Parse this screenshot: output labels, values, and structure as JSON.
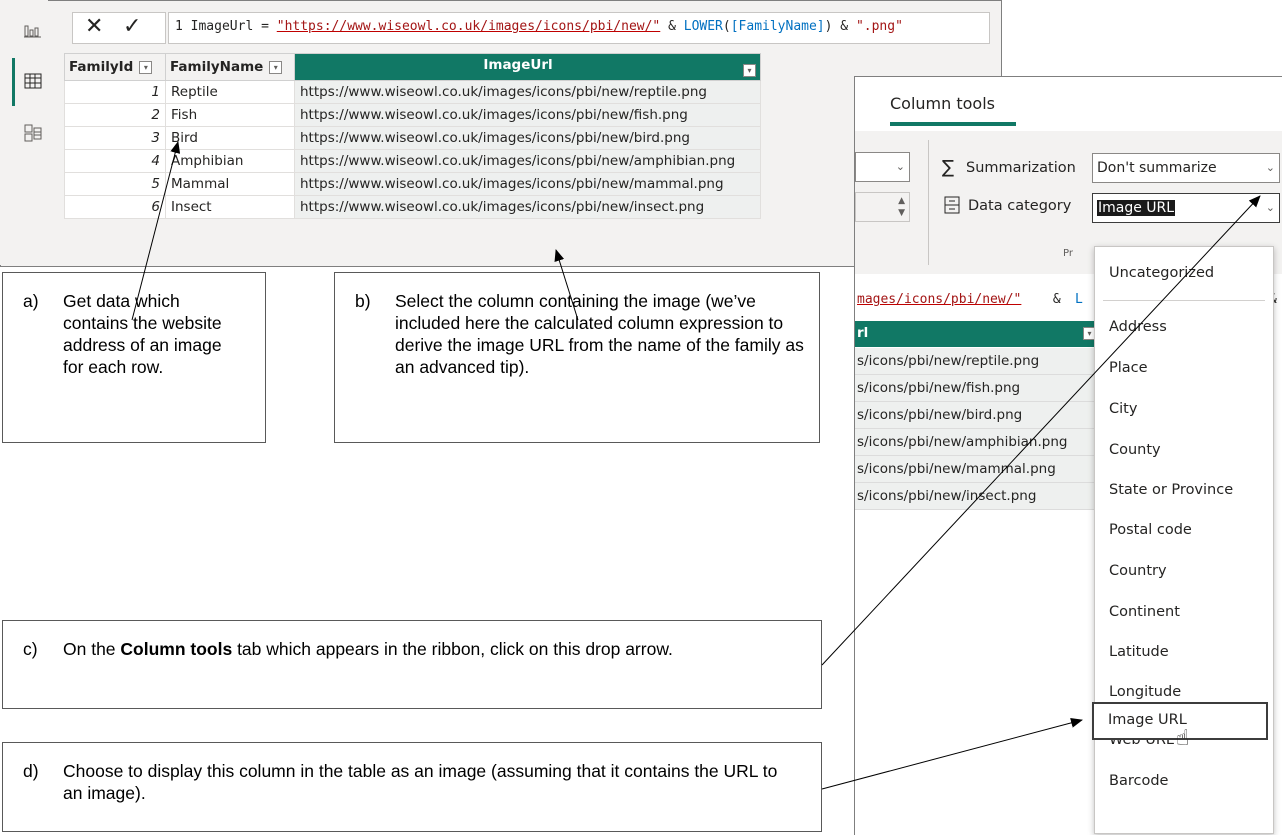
{
  "formula": {
    "line_number": "1",
    "prefix": "ImageUrl = ",
    "string1": "\"https://www.wiseowl.co.uk/images/icons/pbi/new/\"",
    "amp1": " & ",
    "func": "LOWER",
    "open": "(",
    "arg": "[FamilyName]",
    "close": ")",
    "amp2": " & ",
    "string2": "\".png\"",
    "cancel_icon": "✕",
    "commit_icon": "✓"
  },
  "rail": {
    "icons": [
      "report-icon",
      "table-icon",
      "model-icon"
    ]
  },
  "table": {
    "headers": [
      "FamilyId",
      "FamilyName",
      "ImageUrl"
    ],
    "rows": [
      {
        "id": "1",
        "name": "Reptile",
        "url": "https://www.wiseowl.co.uk/images/icons/pbi/new/reptile.png"
      },
      {
        "id": "2",
        "name": "Fish",
        "url": "https://www.wiseowl.co.uk/images/icons/pbi/new/fish.png"
      },
      {
        "id": "3",
        "name": "Bird",
        "url": "https://www.wiseowl.co.uk/images/icons/pbi/new/bird.png"
      },
      {
        "id": "4",
        "name": "Amphibian",
        "url": "https://www.wiseowl.co.uk/images/icons/pbi/new/amphibian.png"
      },
      {
        "id": "5",
        "name": "Mammal",
        "url": "https://www.wiseowl.co.uk/images/icons/pbi/new/mammal.png"
      },
      {
        "id": "6",
        "name": "Insect",
        "url": "https://www.wiseowl.co.uk/images/icons/pbi/new/insect.png"
      }
    ]
  },
  "ribbon": {
    "tab": "Column tools",
    "summarization_label": "Summarization",
    "summarization_value": "Don't summarize",
    "data_category_label": "Data category",
    "data_category_value": "Image URL",
    "group_fragment": "Pr"
  },
  "dax_fragment": {
    "string": "mages/icons/pbi/new/\"",
    "amp": " & ",
    "func": "L",
    "amp2": "&"
  },
  "mini_table": {
    "header": "rl",
    "rows": [
      "s/icons/pbi/new/reptile.png",
      "s/icons/pbi/new/fish.png",
      "s/icons/pbi/new/bird.png",
      "s/icons/pbi/new/amphibian.png",
      "s/icons/pbi/new/mammal.png",
      "s/icons/pbi/new/insect.png"
    ]
  },
  "dropdown": {
    "items": [
      "Uncategorized",
      "Address",
      "Place",
      "City",
      "County",
      "State or Province",
      "Postal code",
      "Country",
      "Continent",
      "Latitude",
      "Longitude",
      "Web URL",
      "Image URL",
      "Barcode"
    ],
    "selected": "Image URL"
  },
  "callouts": {
    "a": {
      "label": "a)",
      "text": "Get data which contains the website address of an image for each row."
    },
    "b": {
      "label": "b)",
      "text": "Select the column containing the image (we’ve included here the calculated column expression to derive the image URL from the name of the family as an advanced tip)."
    },
    "c": {
      "label": "c)",
      "text_before": "On the ",
      "bold": "Column tools",
      "text_after": " tab which appears in the ribbon, click on this drop arrow."
    },
    "d": {
      "label": "d)",
      "text": "Choose to display this column in the table as an image (assuming that it contains the URL to an image)."
    }
  },
  "colors": {
    "accent": "#117865",
    "dax_string": "#a31515",
    "dax_func": "#0070c1",
    "ribbon_bg": "#f3f2f1"
  }
}
